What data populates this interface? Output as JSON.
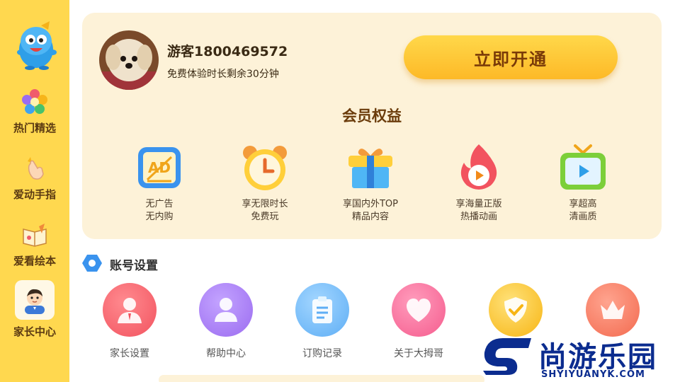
{
  "sidebar": {
    "items": [
      {
        "label": "热门精选",
        "icon": "flower-icon"
      },
      {
        "label": "爱动手指",
        "icon": "finger-icon"
      },
      {
        "label": "爱看绘本",
        "icon": "book-icon"
      },
      {
        "label": "家长中心",
        "icon": "parent-avatar-icon",
        "active": true
      }
    ],
    "mascot_icon": "mascot-logo-icon"
  },
  "member": {
    "username": "游客1800469572",
    "trial_text": "免费体验时长剩余30分钟",
    "open_button": "立即开通",
    "benefits_title": "会员权益",
    "benefits": [
      {
        "icon": "no-ads-icon",
        "line1": "无广告",
        "line2": "无内购"
      },
      {
        "icon": "alarm-clock-icon",
        "line1": "享无限时长",
        "line2": "免费玩"
      },
      {
        "icon": "gift-box-icon",
        "line1": "享国内外TOP",
        "line2": "精品内容"
      },
      {
        "icon": "flame-play-icon",
        "line1": "享海量正版",
        "line2": "热播动画"
      },
      {
        "icon": "tv-play-icon",
        "line1": "享超高",
        "line2": "清画质"
      }
    ]
  },
  "account": {
    "title": "账号设置",
    "items": [
      {
        "label": "家长设置",
        "icon": "parent-settings-icon",
        "color": "#f2535f"
      },
      {
        "label": "帮助中心",
        "icon": "help-person-icon",
        "color": "#9b6cf0"
      },
      {
        "label": "订购记录",
        "icon": "clipboard-icon",
        "color": "#5eaef5"
      },
      {
        "label": "关于大拇哥",
        "icon": "heart-icon",
        "color": "#f55c8e"
      },
      {
        "label": "",
        "icon": "shield-check-icon",
        "color": "#f7b514"
      },
      {
        "label": "",
        "icon": "crown-icon",
        "color": "#f36a4f"
      }
    ]
  },
  "watermark": {
    "text": "尚游乐园",
    "url": "SHYIYUANYK.COM",
    "color": "#0b2c8f"
  },
  "colors": {
    "sidebar": "#ffd84f",
    "card": "#fdf2d8",
    "button": "#fdb927",
    "title": "#6b3c0b"
  }
}
